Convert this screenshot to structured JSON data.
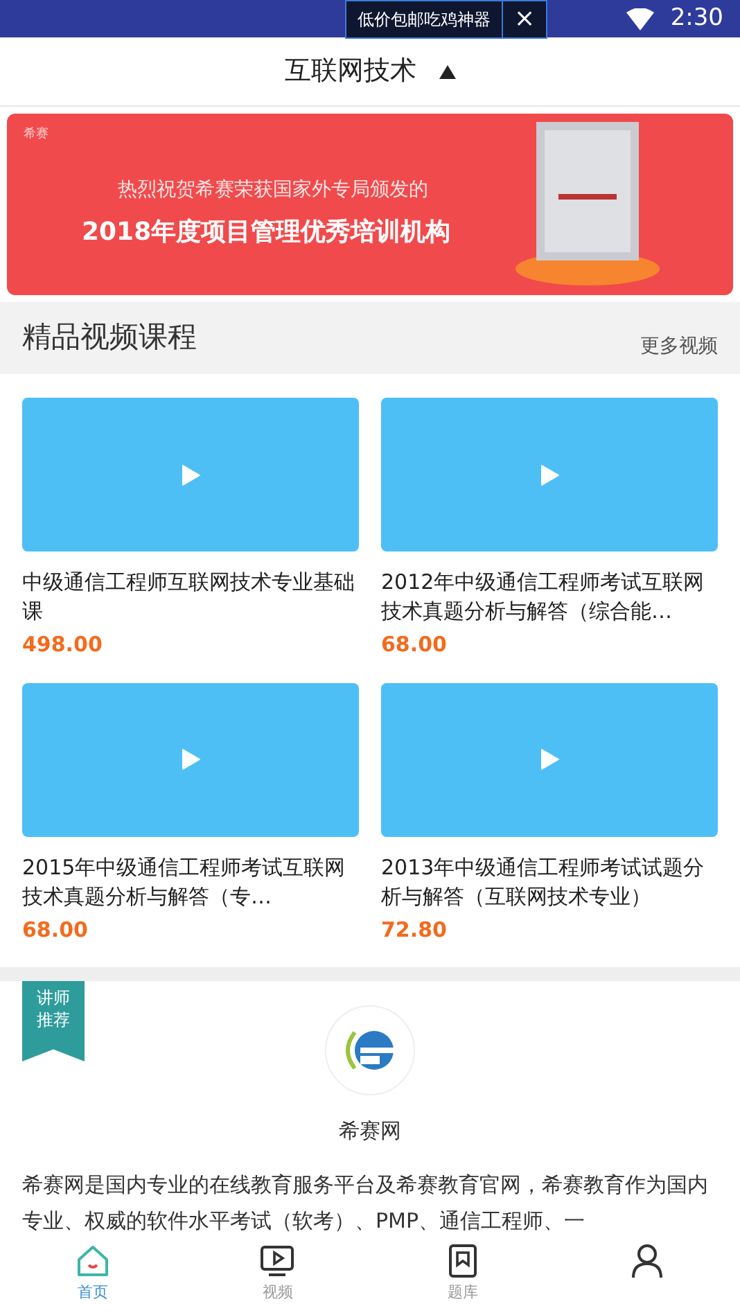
{
  "status_bar": {
    "time": "2:30"
  },
  "toast": {
    "text": "低价包邮吃鸡神器",
    "close": "×"
  },
  "header": {
    "title": "互联网技术",
    "expanded": true
  },
  "banner": {
    "brand": "希赛",
    "line_1": "热烈祝贺希赛荣获国家外专局颁发的",
    "line_2": "2018年度项目管理优秀培训机构"
  },
  "section": {
    "title": "精品视频课程",
    "more": "更多视频"
  },
  "courses": [
    {
      "title": "中级通信工程师互联网技术专业基础课",
      "price": "498.00"
    },
    {
      "title": "2012年中级通信工程师考试互联网技术真题分析与解答（综合能…",
      "price": "68.00"
    },
    {
      "title": "2015年中级通信工程师考试互联网技术真题分析与解答（专…",
      "price": "68.00"
    },
    {
      "title": "2013年中级通信工程师考试试题分析与解答（互联网技术专业）",
      "price": "72.80"
    }
  ],
  "teacher": {
    "ribbon": "讲师推荐",
    "name": "希赛网",
    "description": "希赛网是国内专业的在线教育服务平台及希赛教育官网，希赛教育作为国内专业、权威的软件水平考试（软考）、PMP、通信工程师、一"
  },
  "nav": [
    {
      "kind": "home",
      "label": "首页",
      "selected": true
    },
    {
      "kind": "video",
      "label": "视频",
      "selected": false
    },
    {
      "kind": "bank",
      "label": "题库",
      "selected": false
    },
    {
      "kind": "user",
      "selected": false
    }
  ]
}
